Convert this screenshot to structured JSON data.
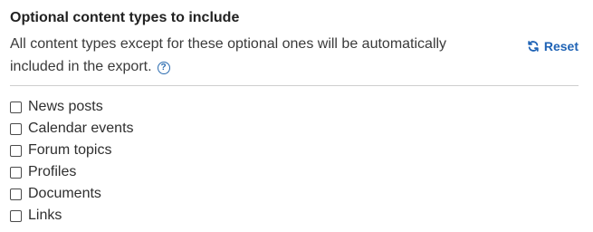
{
  "section": {
    "title": "Optional content types to include",
    "description": "All content types except for these optional ones will be automatically included in the export.",
    "help_icon": "question-circle-icon",
    "reset_label": "Reset",
    "reset_icon": "refresh-icon",
    "accent_color": "#1f63b5"
  },
  "options": [
    {
      "label": "News posts",
      "checked": false
    },
    {
      "label": "Calendar events",
      "checked": false
    },
    {
      "label": "Forum topics",
      "checked": false
    },
    {
      "label": "Profiles",
      "checked": false
    },
    {
      "label": "Documents",
      "checked": false
    },
    {
      "label": "Links",
      "checked": false
    }
  ]
}
